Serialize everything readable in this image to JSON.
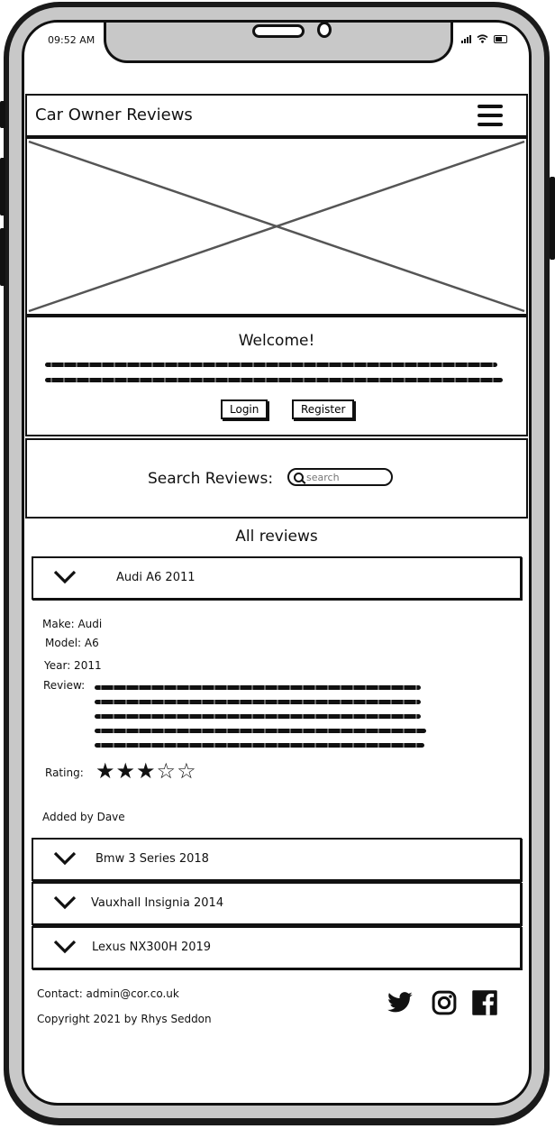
{
  "status_bar": {
    "time": "09:52 AM"
  },
  "nav": {
    "title": "Car Owner Reviews",
    "menu_icon": "hamburger-menu-icon"
  },
  "welcome": {
    "title": "Welcome!",
    "login_label": "Login",
    "register_label": "Register"
  },
  "search": {
    "label": "Search Reviews:",
    "placeholder": "search"
  },
  "reviews": {
    "heading": "All reviews",
    "items": [
      {
        "title": "Audi A6 2011"
      },
      {
        "title": "Bmw 3 Series 2018"
      },
      {
        "title": "Vauxhall Insignia 2014"
      },
      {
        "title": "Lexus NX300H 2019"
      }
    ],
    "expanded": {
      "make": "Make: Audi",
      "model": "Model: A6",
      "year": "Year: 2011",
      "review_label": "Review:",
      "rating_label": "Rating:",
      "rating": 3,
      "rating_max": 5,
      "added_by": "Added by Dave"
    }
  },
  "footer": {
    "contact": "Contact: admin@cor.co.uk",
    "copyright": "Copyright 2021 by Rhys Seddon",
    "social_icons": [
      "twitter-icon",
      "instagram-icon",
      "facebook-icon"
    ]
  }
}
